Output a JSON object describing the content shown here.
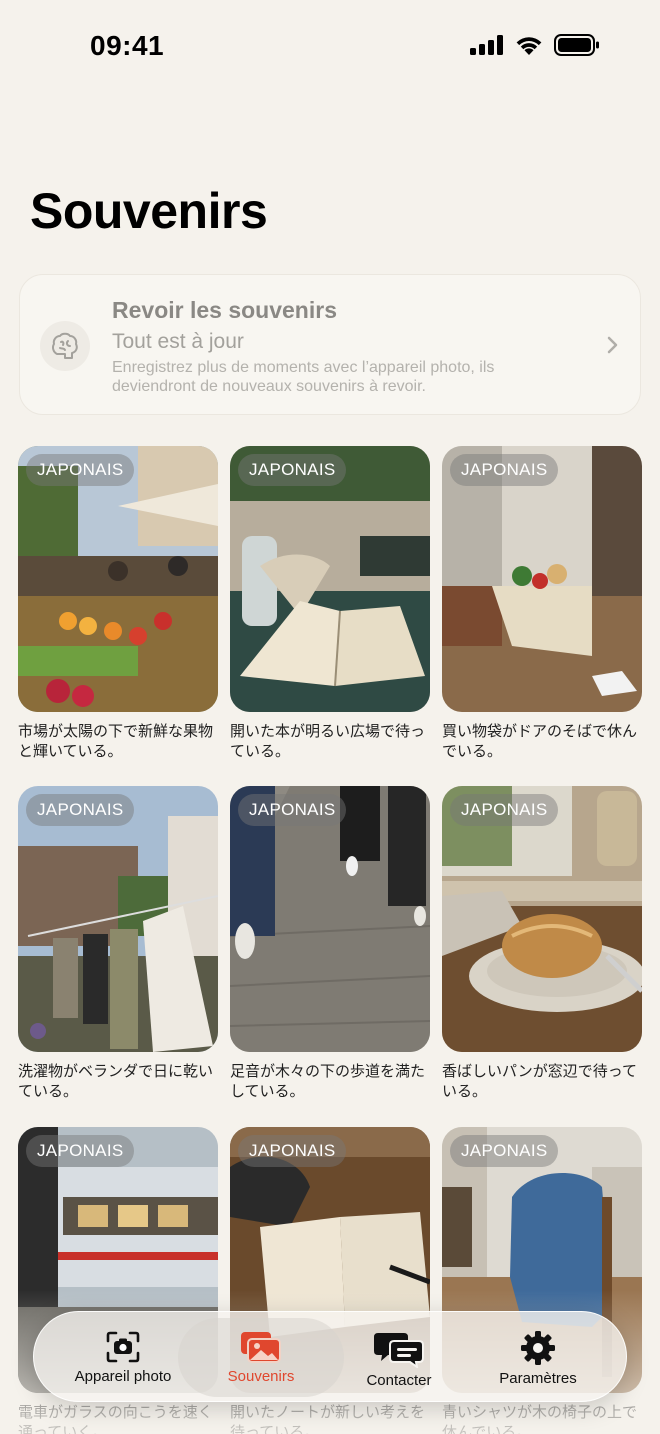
{
  "status_bar": {
    "time": "09:41"
  },
  "title": "Souvenirs",
  "review_card": {
    "title": "Revoir les souvenirs",
    "status": "Tout est à jour",
    "description": "Enregistrez plus de moments avec l’appareil photo, ils deviendront de nouveaux souvenirs à revoir.",
    "icon": "brain-icon"
  },
  "memories": [
    {
      "badge": "JAPONAIS",
      "caption": "市場が太陽の下で新鮮な果物と輝いている。"
    },
    {
      "badge": "JAPONAIS",
      "caption": "開いた本が明るい広場で待っている。"
    },
    {
      "badge": "JAPONAIS",
      "caption": "買い物袋がドアのそばで休んでいる。"
    },
    {
      "badge": "JAPONAIS",
      "caption": "洗濯物がベランダで日に乾いている。"
    },
    {
      "badge": "JAPONAIS",
      "caption": "足音が木々の下の歩道を満たしている。"
    },
    {
      "badge": "JAPONAIS",
      "caption": "香ばしいパンが窓辺で待っている。"
    },
    {
      "badge": "JAPONAIS",
      "caption": "電車がガラスの向こうを速く通っていく。"
    },
    {
      "badge": "JAPONAIS",
      "caption": "開いたノートが新しい考えを待っている。"
    },
    {
      "badge": "JAPONAIS",
      "caption": "青いシャツが木の椅子の上で休んでいる。"
    }
  ],
  "tabs": [
    {
      "label": "Appareil photo",
      "icon": "camera-icon"
    },
    {
      "label": "Souvenirs",
      "icon": "photos-icon",
      "active": true
    },
    {
      "label": "Contacter",
      "icon": "chat-bubbles-icon"
    },
    {
      "label": "Paramètres",
      "icon": "gear-icon"
    }
  ],
  "colors": {
    "accent": "#e0472e",
    "background": "#f5f2ec"
  }
}
